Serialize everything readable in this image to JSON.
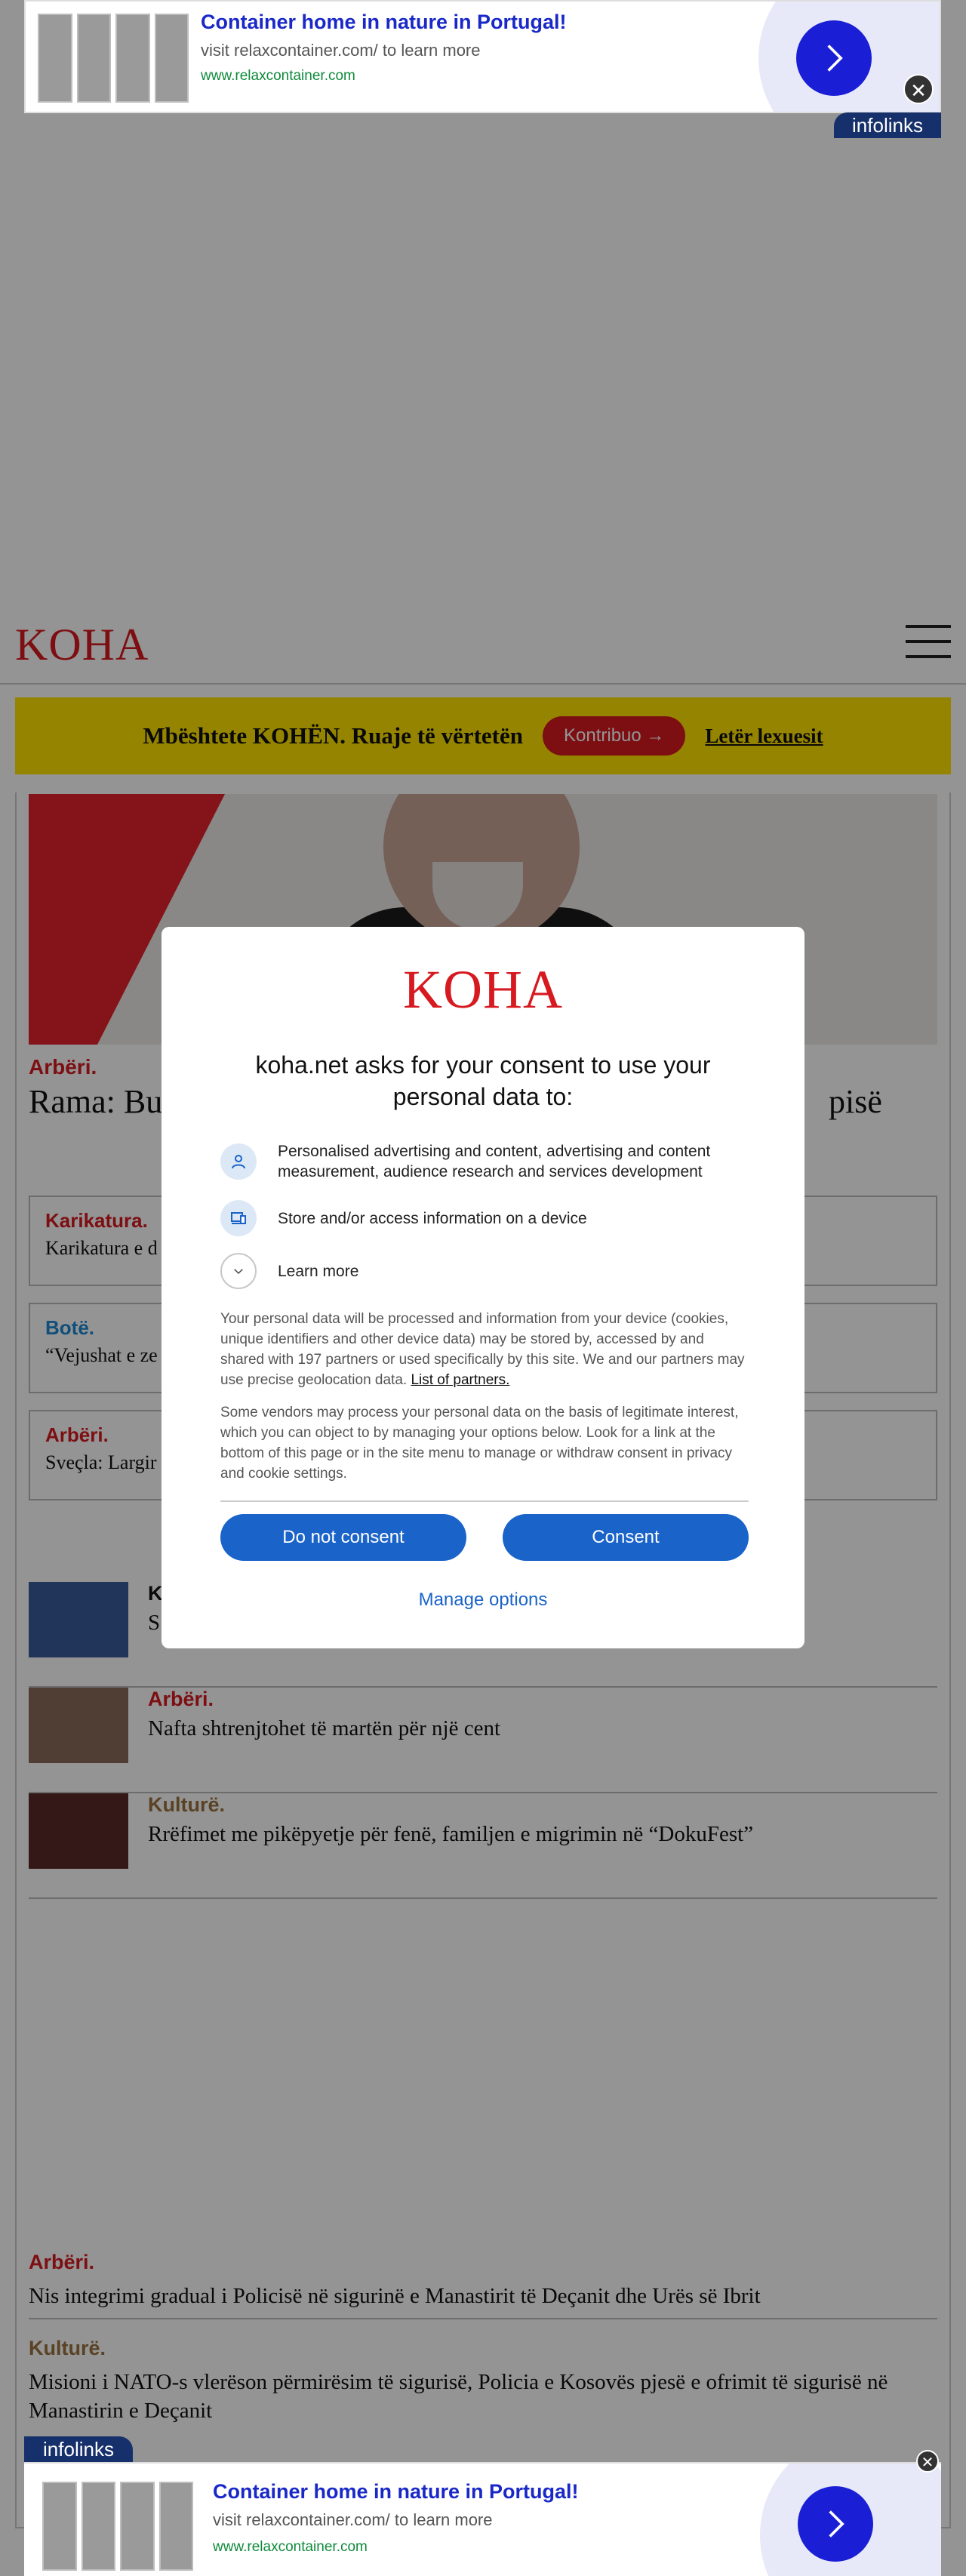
{
  "ad": {
    "title": "Container home in nature in Portugal!",
    "line": "visit relaxcontainer.com/ to learn more",
    "url": "www.relaxcontainer.com",
    "brand": "infolinks",
    "close_symbol": "✕"
  },
  "header": {
    "logo": "KOHA"
  },
  "support": {
    "text": "Mbështete KOHËN. Ruaje të vërtetën",
    "button": "Kontribuo →",
    "link": "Letër lexuesit"
  },
  "lead": {
    "category": "Arbëri.",
    "title": "Rama: Bu",
    "title_end": "pisë"
  },
  "boxes": [
    {
      "category": "Karikatura.",
      "text": "Karikatura e d"
    },
    {
      "category": "Botë.",
      "text": "“Vejushat e ze"
    },
    {
      "category": "Arbëri.",
      "text": "Sveçla: Largir"
    }
  ],
  "list": [
    {
      "category": "K",
      "text": "S"
    },
    {
      "category": "Arbëri.",
      "text": "Nafta shtrenjtohet të martën për një cent"
    },
    {
      "category": "Kulturë.",
      "text": "Rrëfimet me pikëpyetje për fenë, familjen e migrimin në “DokuFest”"
    }
  ],
  "bottom_stories": [
    {
      "category": "Arbëri.",
      "text": "Nis integrimi gradual i Policisë në sigurinë e Manastirit të Deçanit dhe Urës së Ibrit"
    },
    {
      "category": "Kulturë.",
      "text": "Misioni i NATO-s vlerëson përmirësim të sigurisë, Policia e Kosovës pjesë e ofrimit të sigurisë në Manastirin e Deçanit"
    }
  ],
  "consent": {
    "logo": "KOHA",
    "heading": "koha.net asks for your consent to use your personal data to:",
    "purposes": [
      {
        "icon": "person-icon",
        "text": "Personalised advertising and content, advertising and content measurement, audience research and services development"
      },
      {
        "icon": "device-icon",
        "text": "Store and/or access information on a device"
      }
    ],
    "learn_more": "Learn more",
    "para1": "Your personal data will be processed and information from your device (cookies, unique identifiers and other device data) may be stored by, accessed by and shared with 197 partners or used specifically by this site. We and our partners may use precise geolocation data.",
    "partners_link": "List of partners.",
    "para2": "Some vendors may process your personal data on the basis of legitimate interest, which you can object to by managing your options below. Look for a link at the bottom of this page or in the site menu to manage or withdraw consent in privacy and cookie settings.",
    "do_not_consent": "Do not consent",
    "consent": "Consent",
    "manage_options": "Manage options"
  },
  "colors": {
    "brand_red": "#d71920",
    "support_yellow": "#ffe400",
    "consent_blue": "#1a63c9",
    "ad_blue": "#1a1fd6"
  }
}
